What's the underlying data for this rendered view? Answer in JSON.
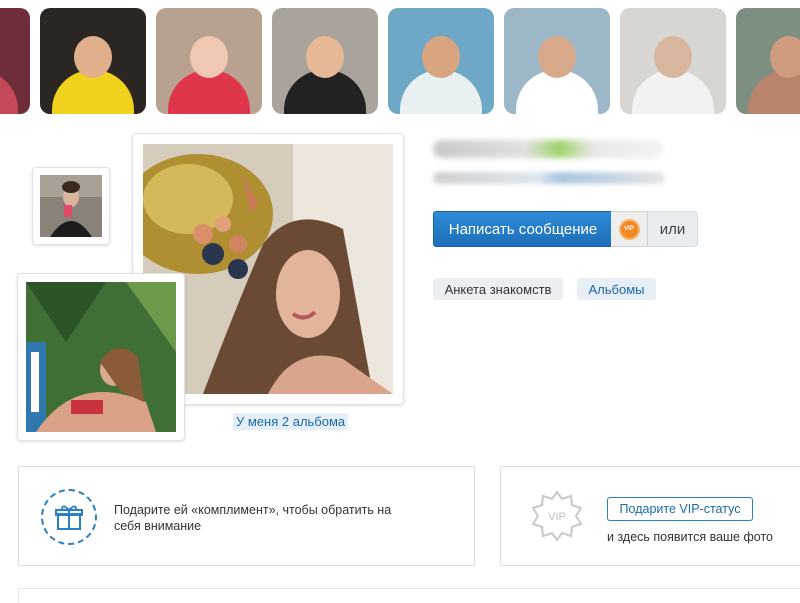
{
  "thumbnails": [
    {
      "name": "profile-thumb-0",
      "bg": "#6f2d3a",
      "skin": "#e7c2ae",
      "shirt": "#c44a5a"
    },
    {
      "name": "profile-thumb-1",
      "bg": "#2b2622",
      "skin": "#e0b08c",
      "shirt": "#f0d21c"
    },
    {
      "name": "profile-thumb-2",
      "bg": "#b9a18f",
      "skin": "#f0c8b2",
      "shirt": "#e0364a"
    },
    {
      "name": "profile-thumb-3",
      "bg": "#a9a39b",
      "skin": "#e7b896",
      "shirt": "#222222"
    },
    {
      "name": "profile-thumb-4",
      "bg": "#6fa7c7",
      "skin": "#d9a480",
      "shirt": "#e9f0f2"
    },
    {
      "name": "profile-thumb-5",
      "bg": "#9bb7c8",
      "skin": "#d8a88a",
      "shirt": "#ffffff"
    },
    {
      "name": "profile-thumb-6",
      "bg": "#d7d6d3",
      "skin": "#d8b69e",
      "shirt": "#f2f2f2"
    },
    {
      "name": "profile-thumb-7",
      "bg": "#7d8f80",
      "skin": "#cf9c7f",
      "shirt": "#b8846b"
    }
  ],
  "profile": {
    "albums_link": "У меня 2 альбома",
    "message_button": "Написать сообщение",
    "vip_badge": "VIP",
    "or_button": "или",
    "dating_profile_link": "Анкета знакомств",
    "albums_button": "Альбомы"
  },
  "gift_card": {
    "text": "Подарите ей «комплимент», чтобы обратить на себя внимание"
  },
  "vip_card": {
    "vip_label": "VIP",
    "button": "Подарите VIP-статус",
    "text": "и здесь появится ваше фото"
  },
  "colors": {
    "accent": "#1d6fb8",
    "link": "#1a6aa8",
    "vip_orange": "#f08a24"
  }
}
